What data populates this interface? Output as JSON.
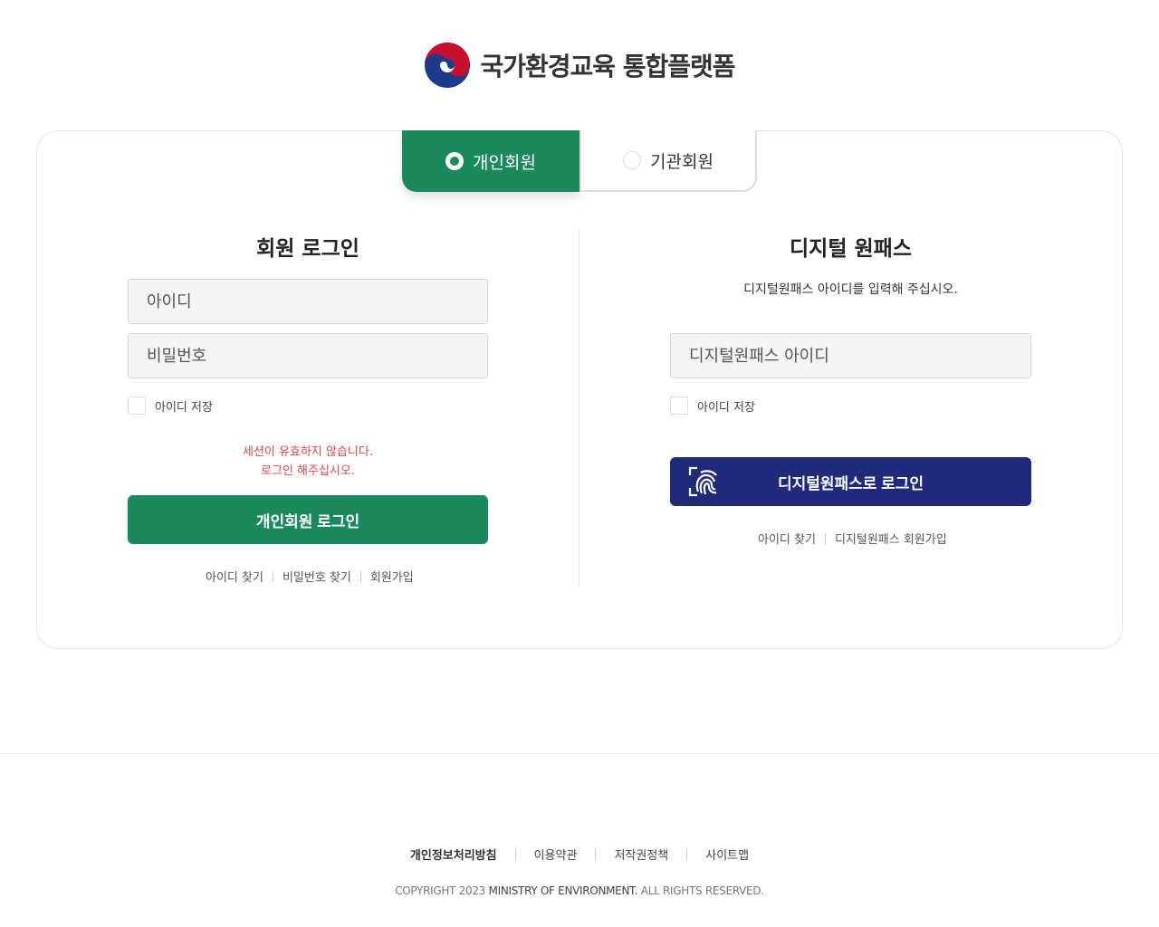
{
  "header": {
    "emblem": "taegeuk-emblem-icon",
    "title": "국가환경교육 통합플랫폼"
  },
  "tabs": [
    {
      "label": "개인회원",
      "selected": true
    },
    {
      "label": "기관회원",
      "selected": false
    }
  ],
  "member_login": {
    "title": "회원 로그인",
    "id_placeholder": "아이디",
    "password_placeholder": "비밀번호",
    "save_id_label": "아이디 저장",
    "error_line1": "세션이 유효하지 않습니다.",
    "error_line2": "로그인 해주십시오.",
    "login_button": "개인회원 로그인",
    "links": [
      "아이디 찾기",
      "비밀번호 찾기",
      "회원가입"
    ]
  },
  "digital_onepass": {
    "title": "디지털 원패스",
    "description": "디지털원패스 아이디를 입력해 주십시오.",
    "id_placeholder": "디지털원패스 아이디",
    "save_id_label": "아이디 저장",
    "login_button": "디지털원패스로 로그인",
    "button_icon": "fingerprint-scan-icon",
    "links": [
      "아이디 찾기",
      "디지털원패스 회원가입"
    ]
  },
  "footer": {
    "links": [
      "개인정보처리방침",
      "이용약관",
      "저작권정책",
      "사이트맵"
    ],
    "copyright_prefix": "COPYRIGHT 2023 ",
    "copyright_org": "MINISTRY OF ENVIRONMENT.",
    "copyright_suffix": " ALL RIGHTS RESERVED."
  },
  "colors": {
    "primary_green": "#1a8a5d",
    "navy": "#1f2a7a",
    "error_red": "#d84a4a"
  }
}
